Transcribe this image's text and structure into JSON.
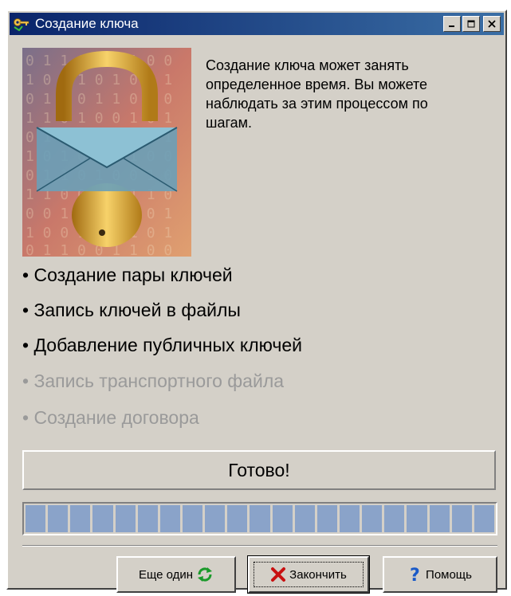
{
  "window": {
    "title": "Создание ключа",
    "controls": [
      "minimize",
      "maximize",
      "close"
    ]
  },
  "intro": {
    "text": "Создание ключа может занять определенное время. Вы можете наблюдать за этим процессом по шагам."
  },
  "steps": [
    {
      "label": "Создание пары ключей",
      "state": "done"
    },
    {
      "label": "Запись ключей в файлы",
      "state": "done"
    },
    {
      "label": "Добавление публичных ключей",
      "state": "done"
    },
    {
      "label": "Запись транспортного файла",
      "state": "pending"
    },
    {
      "label": "Создание договора",
      "state": "pending"
    }
  ],
  "bullet": "•",
  "status": {
    "text": "Готово!"
  },
  "progress": {
    "value": 1.0,
    "segments": 21,
    "color": "#8aa3c9"
  },
  "buttons": {
    "again": {
      "label": "Еще один",
      "icon": "refresh-icon"
    },
    "finish": {
      "label": "Закончить",
      "icon": "red-x-icon"
    },
    "help": {
      "label": "Помощь",
      "icon": "question-icon"
    }
  },
  "colors": {
    "titlebar_start": "#0a246a",
    "titlebar_end": "#3a6ea5",
    "dialog_bg": "#d4d0c8",
    "pending_text": "#9a9a9a"
  }
}
